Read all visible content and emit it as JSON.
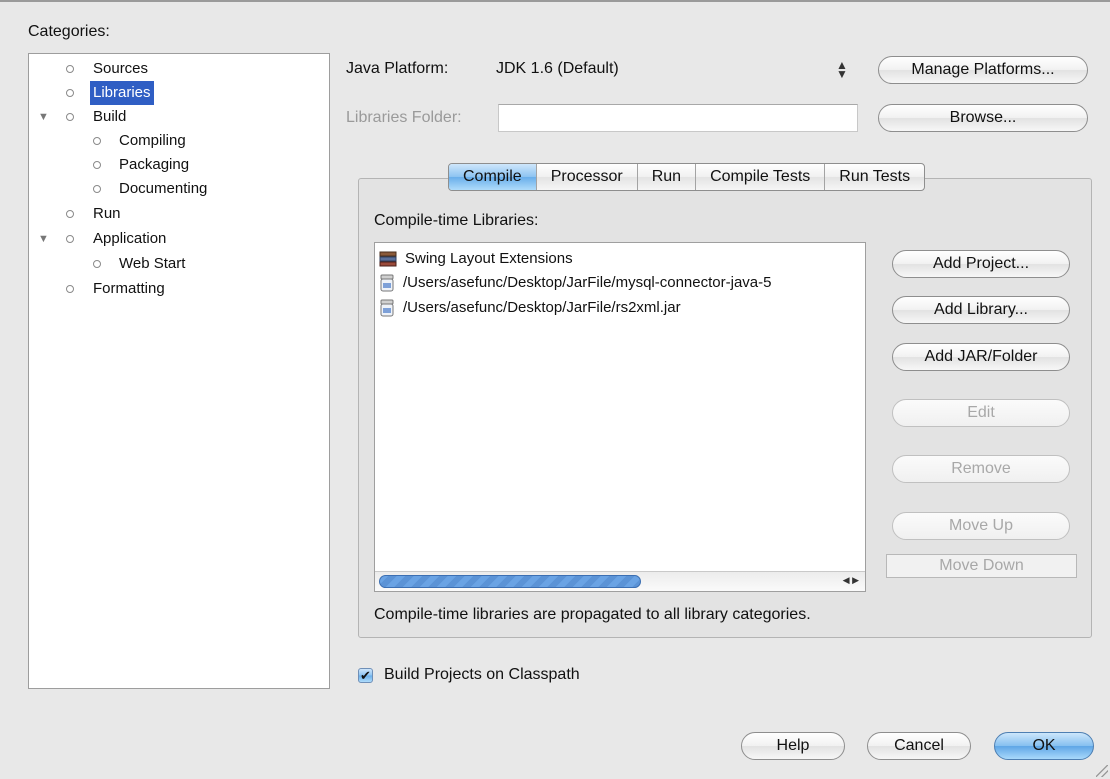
{
  "categories": {
    "title": "Categories:",
    "items": [
      {
        "label": "Sources"
      },
      {
        "label": "Libraries"
      },
      {
        "label": "Build"
      },
      {
        "label": "Compiling"
      },
      {
        "label": "Packaging"
      },
      {
        "label": "Documenting"
      },
      {
        "label": "Run"
      },
      {
        "label": "Application"
      },
      {
        "label": "Web Start"
      },
      {
        "label": "Formatting"
      }
    ],
    "selected": "Libraries"
  },
  "platform": {
    "label": "Java Platform:",
    "value": "JDK 1.6 (Default)",
    "manage_label": "Manage Platforms..."
  },
  "libraries_folder": {
    "label": "Libraries Folder:",
    "value": "",
    "browse_label": "Browse..."
  },
  "tabs": [
    "Compile",
    "Processor",
    "Run",
    "Compile Tests",
    "Run Tests"
  ],
  "active_tab": "Compile",
  "compile": {
    "list_label": "Compile-time Libraries:",
    "items": [
      {
        "label": "Swing Layout Extensions",
        "icon": "library-icon"
      },
      {
        "label": "/Users/asefunc/Desktop/JarFile/mysql-connector-java-5",
        "icon": "jar-icon"
      },
      {
        "label": "/Users/asefunc/Desktop/JarFile/rs2xml.jar",
        "icon": "jar-icon"
      }
    ],
    "buttons": {
      "add_project": "Add Project...",
      "add_library": "Add Library...",
      "add_jar": "Add JAR/Folder",
      "edit": "Edit",
      "remove": "Remove",
      "move_up": "Move Up",
      "move_down": "Move Down"
    },
    "hint": "Compile-time libraries are propagated to all library categories."
  },
  "build_on_classpath": {
    "label": "Build Projects on Classpath",
    "checked": true
  },
  "footer": {
    "help": "Help",
    "cancel": "Cancel",
    "ok": "OK"
  },
  "colors": {
    "selection": "#2f5ec4",
    "default_button": "#69aeea",
    "background": "#e8e8e8"
  }
}
